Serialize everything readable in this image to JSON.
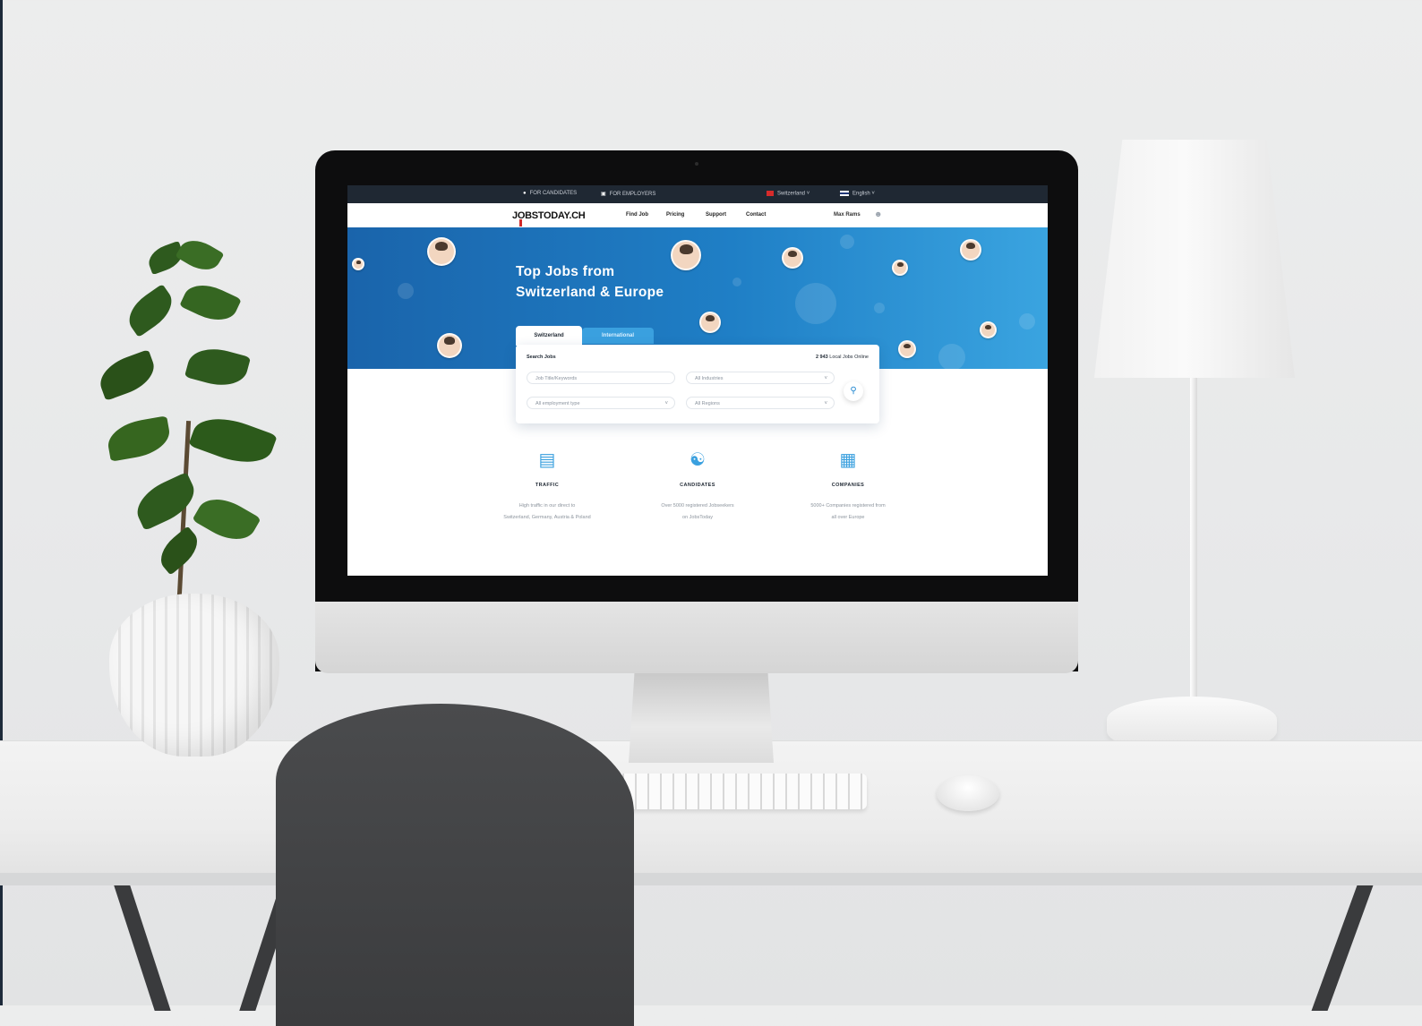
{
  "topbar": {
    "for_candidates": "FOR CANDIDATES",
    "for_employers": "FOR EMPLOYERS",
    "country": "Switzerland",
    "language": "English"
  },
  "navbar": {
    "logo": "JOBSTODAY.CH",
    "links": [
      "Find Job",
      "Pricing",
      "Support",
      "Contact"
    ],
    "user": "Max Rams"
  },
  "hero": {
    "title_line1": "Top Jobs from",
    "title_line2": "Switzerland & Europe"
  },
  "search": {
    "tab_active": "Switzerland",
    "tab_inactive": "International",
    "label": "Search Jobs",
    "count_prefix": "2 943",
    "count_suffix": "Local Jobs Online",
    "field_keywords": "Job Title/Keywords",
    "field_industries": "All Industries",
    "field_employment": "All employment type",
    "field_regions": "All Regions"
  },
  "features": [
    {
      "icon": "chart-monitor-icon",
      "title": "TRAFFIC",
      "desc_line1": "High traffic in our direct to",
      "desc_line2": "Switzerland, Germany, Austria & Poland"
    },
    {
      "icon": "candidates-icon",
      "title": "CANDIDATES",
      "desc_line1": "Over 5000 registered Jobseekers",
      "desc_line2": "on JobsToday"
    },
    {
      "icon": "companies-icon",
      "title": "COMPANIES",
      "desc_line1": "5000+ Companies registered from",
      "desc_line2": "all over Europe"
    }
  ],
  "colors": {
    "brand_blue": "#1f7fc6",
    "dark_bar": "#1f2833",
    "accent_red": "#d12a2a"
  }
}
